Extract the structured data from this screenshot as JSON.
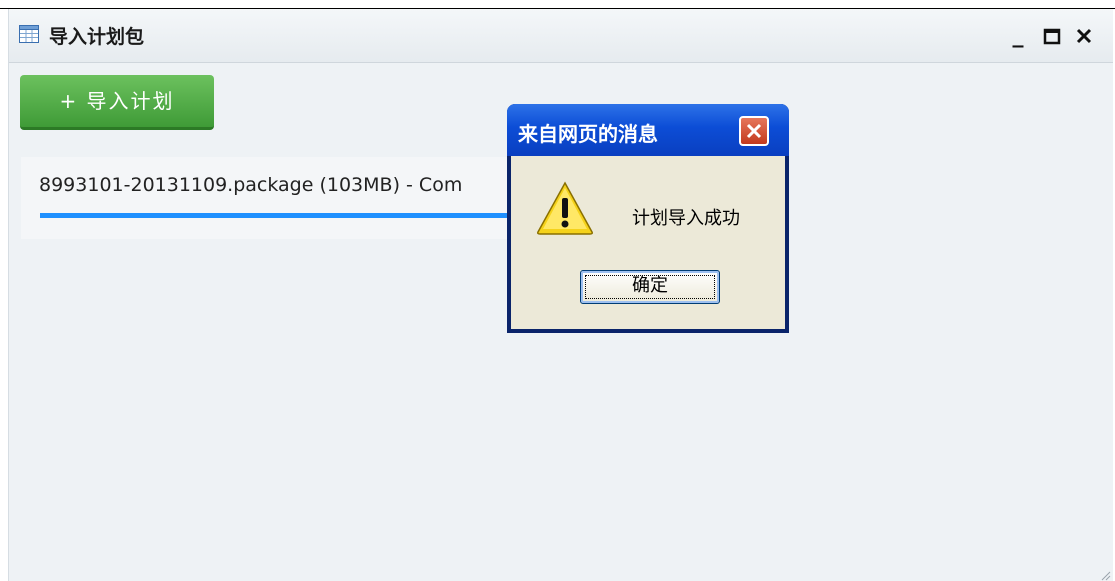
{
  "window": {
    "title": "导入计划包",
    "icon": "table-icon",
    "controls": {
      "minimize": "_",
      "maximize": "□",
      "close": "✕"
    }
  },
  "toolbar": {
    "import_label": "+ 导入计划"
  },
  "upload": {
    "file_text": "8993101-20131109.package (103MB) - Com",
    "progress": 1.0,
    "progress_color": "#1e90ff"
  },
  "dialog": {
    "title": "来自网页的消息",
    "message": "计划导入成功",
    "ok_label": "确定",
    "icon": "warning-icon"
  },
  "colors": {
    "button_green": "#4caf43",
    "dialog_title_blue": "#0c4dd6",
    "dialog_body": "#ece9d8"
  }
}
